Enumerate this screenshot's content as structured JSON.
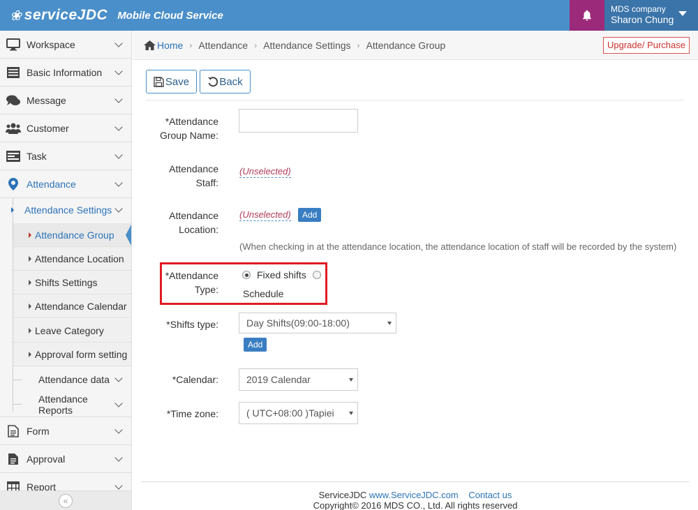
{
  "header": {
    "logo_brand": "serviceJDC",
    "logo_tagline": "Mobile Cloud Service",
    "company": "MDS company",
    "user_name": "Sharon Chung",
    "accent_color": "#4a8fc9",
    "bell_bg_color": "#9c2a7a"
  },
  "sidebar": {
    "items": [
      {
        "label": "Workspace",
        "icon": "monitor-icon"
      },
      {
        "label": "Basic Information",
        "icon": "list-icon"
      },
      {
        "label": "Message",
        "icon": "chat-icon"
      },
      {
        "label": "Customer",
        "icon": "users-icon"
      },
      {
        "label": "Task",
        "icon": "task-icon"
      },
      {
        "label": "Attendance",
        "icon": "location-pin-icon"
      }
    ],
    "attendance_settings": "Attendance Settings",
    "settings_children": [
      "Attendance Group",
      "Attendance Location",
      "Shifts Settings",
      "Attendance Calendar",
      "Leave Category",
      "Approval form setting"
    ],
    "attendance_data": "Attendance data",
    "attendance_reports": "Attendance Reports",
    "bottom_items": [
      {
        "label": "Form",
        "icon": "document-icon"
      },
      {
        "label": "Approval",
        "icon": "approval-icon"
      },
      {
        "label": "Report",
        "icon": "table-icon"
      }
    ],
    "collapse": "«"
  },
  "breadcrumb": [
    "Home",
    "Attendance",
    "Attendance Settings",
    "Attendance Group"
  ],
  "upgrade_label": "Upgrade/ Purchase",
  "toolbar": {
    "save_label": "Save",
    "back_label": "Back"
  },
  "form": {
    "group_name_label_1": "*Attendance",
    "group_name_label_2": "Group Name:",
    "group_name_value": "",
    "staff_label_1": "Attendance",
    "staff_label_2": "Staff:",
    "staff_value": "(Unselected)",
    "location_label_1": "Attendance",
    "location_label_2": "Location:",
    "location_value": "(Unselected)",
    "location_add": "Add",
    "location_hint": "(When checking in at the attendance location, the attendance location of staff will be recorded by the system)",
    "type_label_1": "*Attendance",
    "type_label_2": "Type:",
    "type_options": [
      "Fixed shifts",
      "Schedule"
    ],
    "type_selected": "Fixed shifts",
    "shifts_label": "*Shifts type:",
    "shifts_value": "Day Shifts(09:00-18:00)",
    "shifts_add": "Add",
    "calendar_label": "*Calendar:",
    "calendar_value": "2019 Calendar",
    "timezone_label": "*Time zone:",
    "timezone_value": "( UTC+08:00 )Tapiei"
  },
  "footer": {
    "brand": "ServiceJDC",
    "url": "www.ServiceJDC.com",
    "contact": "Contact us",
    "copyright": "Copyright© 2016 MDS CO., Ltd. All rights reserved"
  }
}
